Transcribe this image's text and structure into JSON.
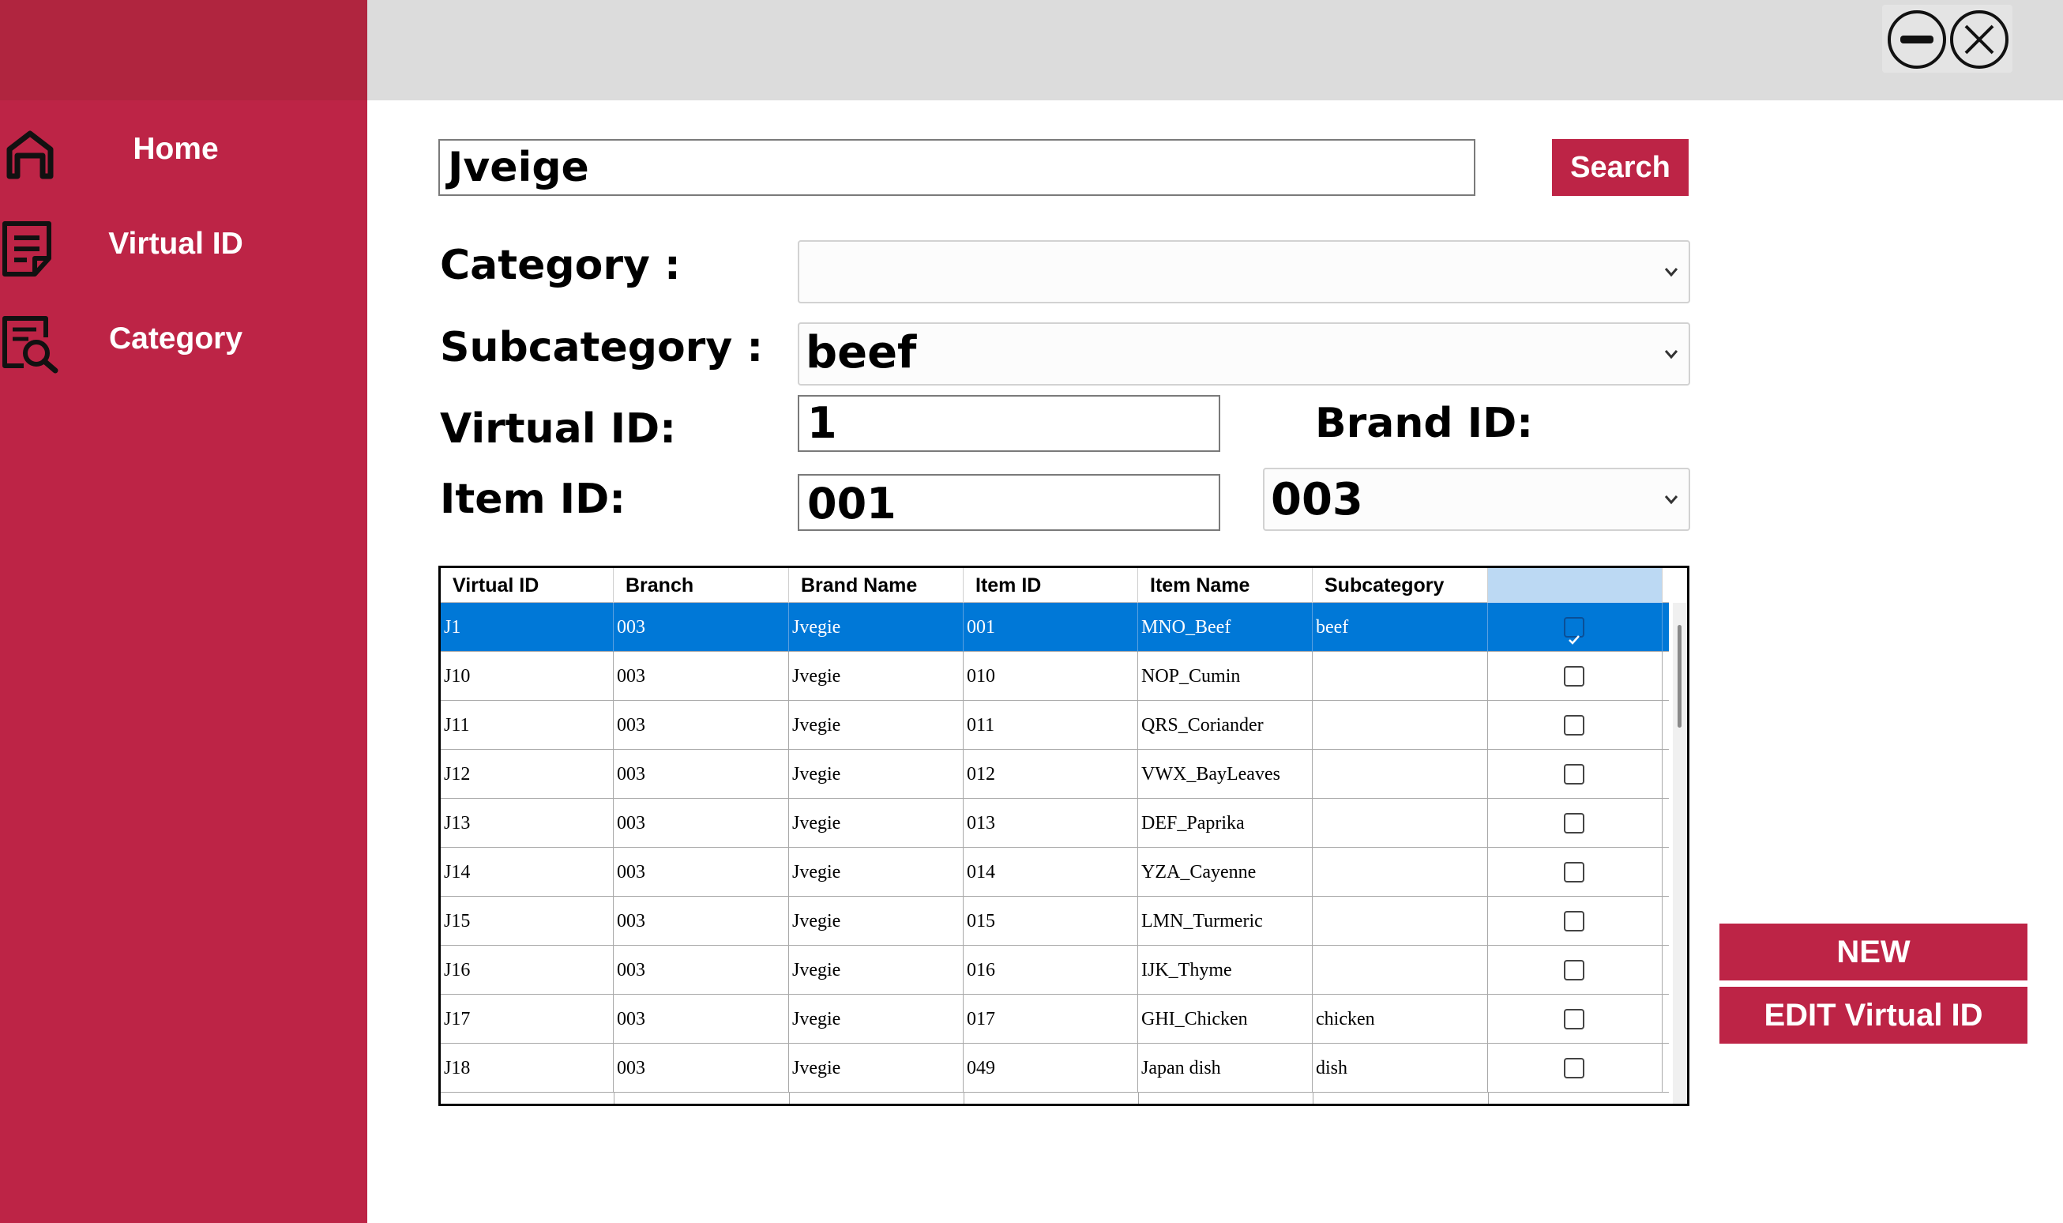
{
  "sidebar": {
    "items": [
      {
        "label": "Home",
        "icon": "home-icon"
      },
      {
        "label": "Virtual ID",
        "icon": "document-icon"
      },
      {
        "label": "Category",
        "icon": "search-document-icon"
      }
    ]
  },
  "window": {
    "minimize_icon": "minimize-circle-icon",
    "close_icon": "close-circle-icon"
  },
  "search": {
    "value": "Jveige",
    "button_label": "Search"
  },
  "form": {
    "category_label": "Category :",
    "category_value": "",
    "subcategory_label": "Subcategory :",
    "subcategory_value": "beef",
    "virtual_id_label": "Virtual ID:",
    "virtual_id_value": "1",
    "brand_id_label": "Brand ID:",
    "brand_id_value": "003",
    "item_id_label": "Item ID:",
    "item_id_value": "001"
  },
  "table": {
    "columns": [
      "Virtual ID",
      "Branch",
      "Brand Name",
      "Item ID",
      "Item Name",
      "Subcategory",
      ""
    ],
    "rows": [
      {
        "virtual_id": "J1",
        "branch": "003",
        "brand": "Jvegie",
        "item_id": "001",
        "item_name": "MNO_Beef",
        "subcategory": "beef",
        "checked": true,
        "selected": true
      },
      {
        "virtual_id": "J10",
        "branch": "003",
        "brand": "Jvegie",
        "item_id": "010",
        "item_name": "NOP_Cumin",
        "subcategory": "",
        "checked": false,
        "selected": false
      },
      {
        "virtual_id": "J11",
        "branch": "003",
        "brand": "Jvegie",
        "item_id": "011",
        "item_name": "QRS_Coriander",
        "subcategory": "",
        "checked": false,
        "selected": false
      },
      {
        "virtual_id": "J12",
        "branch": "003",
        "brand": "Jvegie",
        "item_id": "012",
        "item_name": "VWX_BayLeaves",
        "subcategory": "",
        "checked": false,
        "selected": false
      },
      {
        "virtual_id": "J13",
        "branch": "003",
        "brand": "Jvegie",
        "item_id": "013",
        "item_name": "DEF_Paprika",
        "subcategory": "",
        "checked": false,
        "selected": false
      },
      {
        "virtual_id": "J14",
        "branch": "003",
        "brand": "Jvegie",
        "item_id": "014",
        "item_name": "YZA_Cayenne",
        "subcategory": "",
        "checked": false,
        "selected": false
      },
      {
        "virtual_id": "J15",
        "branch": "003",
        "brand": "Jvegie",
        "item_id": "015",
        "item_name": "LMN_Turmeric",
        "subcategory": "",
        "checked": false,
        "selected": false
      },
      {
        "virtual_id": "J16",
        "branch": "003",
        "brand": "Jvegie",
        "item_id": "016",
        "item_name": "IJK_Thyme",
        "subcategory": "",
        "checked": false,
        "selected": false
      },
      {
        "virtual_id": "J17",
        "branch": "003",
        "brand": "Jvegie",
        "item_id": "017",
        "item_name": "GHI_Chicken",
        "subcategory": "chicken",
        "checked": false,
        "selected": false
      },
      {
        "virtual_id": "J18",
        "branch": "003",
        "brand": "Jvegie",
        "item_id": "049",
        "item_name": "Japan dish",
        "subcategory": "dish",
        "checked": false,
        "selected": false
      }
    ]
  },
  "actions": {
    "new_label": "NEW",
    "edit_label": "EDIT Virtual ID"
  },
  "colors": {
    "accent": "#bd2446",
    "selection": "#0078d7"
  }
}
